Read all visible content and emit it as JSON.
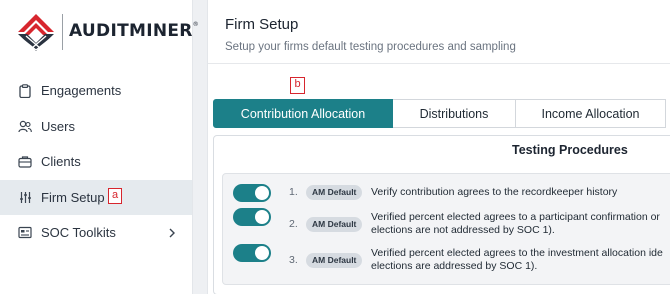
{
  "brand": {
    "name": "AUDITMINER",
    "trademark": "®",
    "logo_icon": "auditminer-mountain-logo",
    "colors": {
      "logo_red": "#d7262e",
      "logo_dark": "#1c2430"
    }
  },
  "sidebar": {
    "items": [
      {
        "label": "Engagements",
        "icon": "clipboard-icon",
        "active": false
      },
      {
        "label": "Users",
        "icon": "users-icon",
        "active": false
      },
      {
        "label": "Clients",
        "icon": "briefcase-icon",
        "active": false
      },
      {
        "label": "Firm Setup",
        "icon": "sliders-icon",
        "active": true
      },
      {
        "label": "SOC Toolkits",
        "icon": "toolkit-icon",
        "active": false,
        "has_submenu": true
      }
    ]
  },
  "markers": {
    "a": "a",
    "b": "b"
  },
  "header": {
    "title": "Firm Setup",
    "subtitle": "Setup your firms default testing procedures and sampling"
  },
  "tabs": [
    {
      "label": "Contribution Allocation",
      "active": true
    },
    {
      "label": "Distributions",
      "active": false
    },
    {
      "label": "Income Allocation",
      "active": false
    }
  ],
  "panel": {
    "title": "Testing Procedures",
    "procedures": [
      {
        "number": "1.",
        "badge": "AM Default",
        "enabled": true,
        "line1": "Verify contribution agrees to the recordkeeper history",
        "line2": ""
      },
      {
        "number": "2.",
        "badge": "AM Default",
        "enabled": true,
        "line1": "Verified percent elected agrees to a participant confirmation or",
        "line2": "elections are not addressed by SOC 1)."
      },
      {
        "number": "3.",
        "badge": "AM Default",
        "enabled": true,
        "line1": "Verified percent elected agrees to the investment allocation ide",
        "line2": "elections are addressed by SOC 1)."
      }
    ]
  },
  "colors": {
    "accent": "#1c8089",
    "active_nav_bg": "#e5eaee",
    "marker": "#d7262e"
  }
}
